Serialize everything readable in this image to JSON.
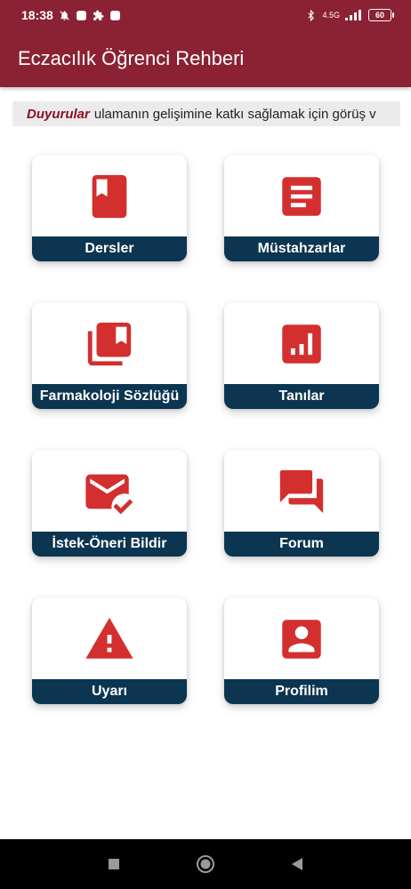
{
  "status_bar": {
    "time": "18:38",
    "network": "4.5G",
    "battery": "60",
    "icons": [
      "muted-notification-icon",
      "app-notification-icon",
      "puzzle-icon",
      "app-notification-icon",
      "bluetooth-icon",
      "signal-icon",
      "battery-icon"
    ]
  },
  "app_bar": {
    "title": "Eczacılık Öğrenci Rehberi"
  },
  "announcement": {
    "title": "Duyurular",
    "text": "ulamanın gelişimine katkı sağlamak için görüş v"
  },
  "menu": {
    "items": [
      {
        "label": "Dersler",
        "icon": "book-icon"
      },
      {
        "label": "Müstahzarlar",
        "icon": "document-icon"
      },
      {
        "label": "Farmakoloji Sözlüğü",
        "icon": "library-icon"
      },
      {
        "label": "Tanılar",
        "icon": "bar-chart-icon"
      },
      {
        "label": "İstek-Öneri Bildir",
        "icon": "mail-check-icon"
      },
      {
        "label": "Forum",
        "icon": "forum-icon"
      },
      {
        "label": "Uyarı",
        "icon": "warning-icon"
      },
      {
        "label": "Profilim",
        "icon": "profile-icon"
      }
    ]
  },
  "colors": {
    "primary": "#8a2233",
    "icon_red": "#d32f2f",
    "label_bg": "#0b3550",
    "announcement_title": "#8a1020"
  },
  "nav_bar": {
    "icons": [
      "recent-apps-icon",
      "home-icon",
      "back-icon"
    ]
  }
}
